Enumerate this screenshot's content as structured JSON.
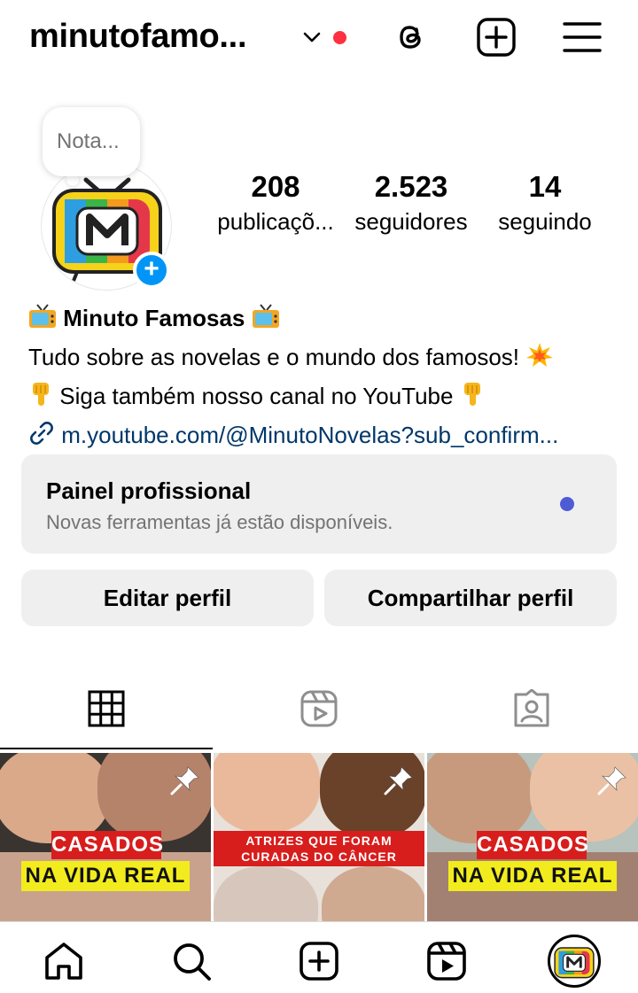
{
  "header": {
    "username": "minutofamo...",
    "icons": [
      "chevron-down-icon",
      "threads-icon",
      "create-post-icon",
      "menu-icon"
    ],
    "notification_dot_color": "#ff3040"
  },
  "profile": {
    "note_text": "Nota...",
    "stats": [
      {
        "count": "208",
        "label": "publicaçõ..."
      },
      {
        "count": "2.523",
        "label": "seguidores"
      },
      {
        "count": "14",
        "label": "seguindo"
      }
    ]
  },
  "bio": {
    "name": "Minuto Famosas",
    "line1": "Tudo sobre as novelas e o mundo dos famosos!",
    "line2": "Siga também nosso canal no YouTube",
    "link": "m.youtube.com/@MinutoNovelas?sub_confirm..."
  },
  "dashboard": {
    "title": "Painel profissional",
    "subtitle": "Novas ferramentas já estão disponíveis.",
    "dot_color": "#4f5bd5"
  },
  "actions": {
    "edit": "Editar perfil",
    "share": "Compartilhar perfil"
  },
  "tabs": [
    "grid-icon",
    "reels-icon",
    "tagged-icon"
  ],
  "posts": [
    {
      "line1": "CASADOS",
      "line2": "NA VIDA REAL",
      "pinned": true
    },
    {
      "line1": "ATRIZES QUE FORAM",
      "line2": "CURADAS DO CÂNCER",
      "pinned": true
    },
    {
      "line1": "CASADOS",
      "line2": "NA VIDA REAL",
      "pinned": true
    }
  ],
  "bottom_nav": [
    "home-icon",
    "search-icon",
    "create-icon",
    "reels-icon",
    "profile-avatar"
  ],
  "colors": {
    "accent_blue": "#0095f6",
    "link": "#00376b",
    "panel_bg": "#efefef"
  }
}
